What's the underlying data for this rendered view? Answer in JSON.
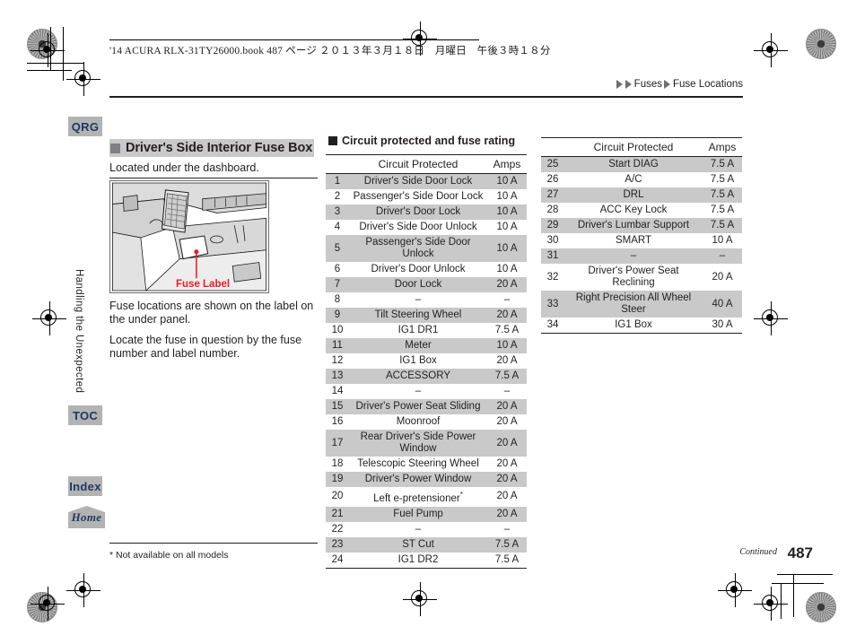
{
  "book_info": "'14 ACURA RLX-31TY26000.book  487 ページ  ２０１３年３月１８日　月曜日　午後３時１８分",
  "breadcrumb": {
    "level1": "Fuses",
    "level2": "Fuse Locations"
  },
  "sidebar": {
    "qrg": "QRG",
    "toc": "TOC",
    "index": "Index",
    "home": "Home",
    "section_vertical": "Handling the Unexpected"
  },
  "left_column": {
    "section_title": "Driver's Side Interior Fuse Box",
    "located_text": "Located under the dashboard.",
    "illustration_label": "Fuse Label",
    "para_1": "Fuse locations are shown on the label on the under panel.",
    "para_2": "Locate the fuse in question by the fuse number and label number.",
    "footnote": "* Not available on all models"
  },
  "middle_table": {
    "heading": "Circuit protected and fuse rating",
    "columns": [
      "",
      "Circuit Protected",
      "Amps"
    ],
    "rows": [
      {
        "no": "1",
        "circuit": "Driver's Side Door Lock",
        "amps": "10 A"
      },
      {
        "no": "2",
        "circuit": "Passenger's Side Door Lock",
        "amps": "10 A"
      },
      {
        "no": "3",
        "circuit": "Driver's Door Lock",
        "amps": "10 A"
      },
      {
        "no": "4",
        "circuit": "Driver's Side Door Unlock",
        "amps": "10 A"
      },
      {
        "no": "5",
        "circuit": "Passenger's Side Door Unlock",
        "amps": "10 A"
      },
      {
        "no": "6",
        "circuit": "Driver's Door Unlock",
        "amps": "10 A"
      },
      {
        "no": "7",
        "circuit": "Door Lock",
        "amps": "20 A"
      },
      {
        "no": "8",
        "circuit": "–",
        "amps": "–"
      },
      {
        "no": "9",
        "circuit": "Tilt Steering Wheel",
        "amps": "20 A"
      },
      {
        "no": "10",
        "circuit": "IG1 DR1",
        "amps": "7.5 A"
      },
      {
        "no": "11",
        "circuit": "Meter",
        "amps": "10 A"
      },
      {
        "no": "12",
        "circuit": "IG1 Box",
        "amps": "20 A"
      },
      {
        "no": "13",
        "circuit": "ACCESSORY",
        "amps": "7.5 A"
      },
      {
        "no": "14",
        "circuit": "–",
        "amps": "–"
      },
      {
        "no": "15",
        "circuit": "Driver's Power Seat Sliding",
        "amps": "20 A"
      },
      {
        "no": "16",
        "circuit": "Moonroof",
        "amps": "20 A"
      },
      {
        "no": "17",
        "circuit": "Rear Driver's Side Power Window",
        "amps": "20 A"
      },
      {
        "no": "18",
        "circuit": "Telescopic Steering Wheel",
        "amps": "20 A"
      },
      {
        "no": "19",
        "circuit": "Driver's Power Window",
        "amps": "20 A"
      },
      {
        "no": "20",
        "circuit": "Left e-pretensioner*",
        "amps": "20 A"
      },
      {
        "no": "21",
        "circuit": "Fuel Pump",
        "amps": "20 A"
      },
      {
        "no": "22",
        "circuit": "–",
        "amps": "–"
      },
      {
        "no": "23",
        "circuit": "ST Cut",
        "amps": "7.5 A"
      },
      {
        "no": "24",
        "circuit": "IG1 DR2",
        "amps": "7.5 A"
      }
    ]
  },
  "right_table": {
    "columns": [
      "",
      "Circuit Protected",
      "Amps"
    ],
    "rows": [
      {
        "no": "25",
        "circuit": "Start DIAG",
        "amps": "7.5 A"
      },
      {
        "no": "26",
        "circuit": "A/C",
        "amps": "7.5 A"
      },
      {
        "no": "27",
        "circuit": "DRL",
        "amps": "7.5 A"
      },
      {
        "no": "28",
        "circuit": "ACC Key Lock",
        "amps": "7.5 A"
      },
      {
        "no": "29",
        "circuit": "Driver's Lumbar Support",
        "amps": "7.5 A"
      },
      {
        "no": "30",
        "circuit": "SMART",
        "amps": "10 A"
      },
      {
        "no": "31",
        "circuit": "–",
        "amps": "–"
      },
      {
        "no": "32",
        "circuit": "Driver's Power Seat Reclining",
        "amps": "20 A"
      },
      {
        "no": "33",
        "circuit": "Right Precision All Wheel Steer",
        "amps": "40 A"
      },
      {
        "no": "34",
        "circuit": "IG1 Box",
        "amps": "30 A"
      }
    ]
  },
  "footer": {
    "continued": "Continued",
    "page_number": "487"
  },
  "colors": {
    "tab_gray": "#b3b3b3",
    "tab_text_navy": "#1f3864",
    "row_stripe": "#c9c9c9",
    "label_red": "#ed1c24",
    "ink": "#231f20"
  }
}
